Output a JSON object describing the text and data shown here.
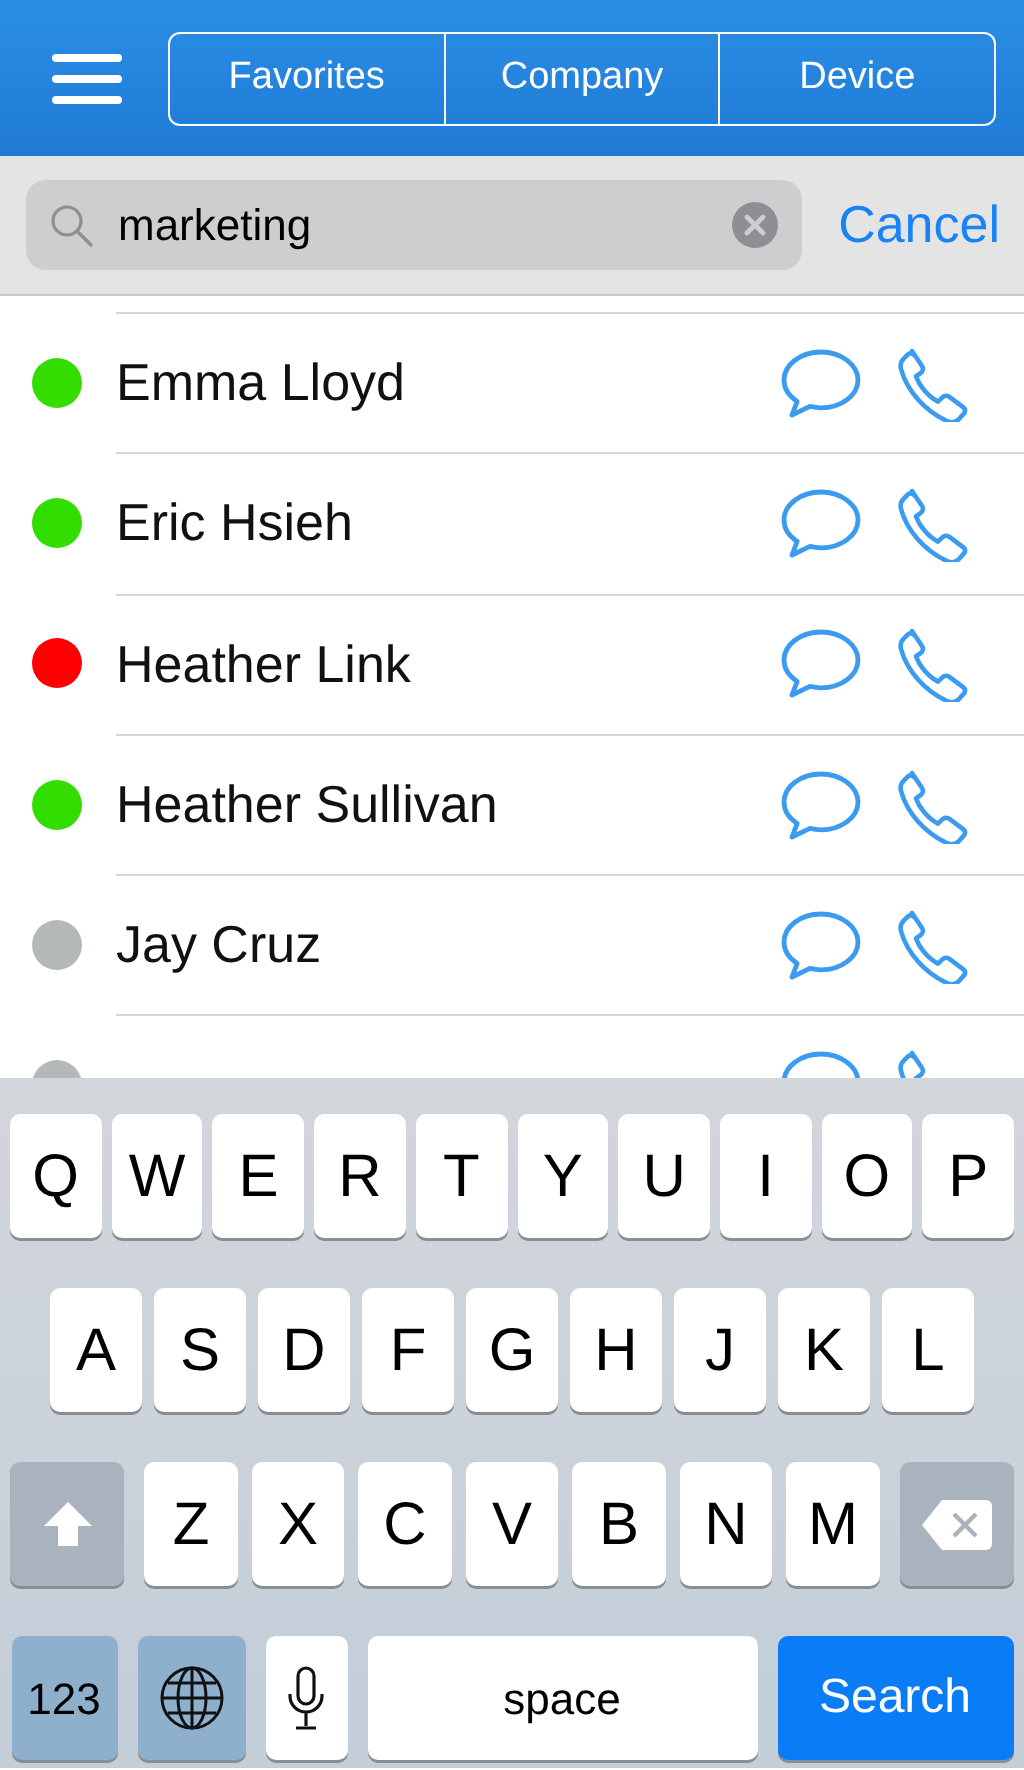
{
  "header": {
    "segments": [
      {
        "label": "Favorites"
      },
      {
        "label": "Company"
      },
      {
        "label": "Device"
      }
    ]
  },
  "search": {
    "value": "marketing",
    "cancel": "Cancel"
  },
  "contacts": [
    {
      "name": "Emma Lloyd",
      "color": "#33dd00"
    },
    {
      "name": "Eric Hsieh",
      "color": "#33dd00"
    },
    {
      "name": "Heather Link",
      "color": "#ff0000"
    },
    {
      "name": "Heather Sullivan",
      "color": "#33dd00"
    },
    {
      "name": "Jay Cruz",
      "color": "#b3b8b8"
    },
    {
      "color": "#b3b8b8"
    }
  ],
  "keyboard": {
    "top_row": [
      {
        "kind": "letter",
        "label": "Q"
      },
      {
        "kind": "letter",
        "label": "W"
      },
      {
        "kind": "letter",
        "label": "E"
      },
      {
        "kind": "letter",
        "label": "R"
      },
      {
        "kind": "letter",
        "label": "T"
      },
      {
        "kind": "letter",
        "label": "Y"
      },
      {
        "kind": "letter",
        "label": "U"
      },
      {
        "kind": "letter",
        "label": "I"
      },
      {
        "kind": "letter",
        "label": "O"
      },
      {
        "kind": "letter",
        "label": "P"
      }
    ],
    "middle_row": [
      {
        "kind": "letter",
        "label": "A"
      },
      {
        "kind": "letter",
        "label": "S"
      },
      {
        "kind": "letter",
        "label": "D"
      },
      {
        "kind": "letter",
        "label": "F"
      },
      {
        "kind": "letter",
        "label": "G"
      },
      {
        "kind": "letter",
        "label": "H"
      },
      {
        "kind": "letter",
        "label": "J"
      },
      {
        "kind": "letter",
        "label": "K"
      },
      {
        "kind": "letter",
        "label": "L"
      }
    ],
    "shift_row": [
      {
        "kind": "shift"
      },
      {
        "kind": "letter",
        "label": "Z"
      },
      {
        "kind": "letter",
        "label": "X"
      },
      {
        "kind": "letter",
        "label": "C"
      },
      {
        "kind": "letter",
        "label": "V"
      },
      {
        "kind": "letter",
        "label": "B"
      },
      {
        "kind": "letter",
        "label": "N"
      },
      {
        "kind": "letter",
        "label": "M"
      },
      {
        "kind": "delete"
      }
    ],
    "bottom_row": [
      {
        "kind": "numbers",
        "label": "123"
      },
      {
        "kind": "globe"
      },
      {
        "kind": "mic"
      },
      {
        "kind": "space",
        "label": "space"
      },
      {
        "kind": "search",
        "label": "Search"
      }
    ]
  }
}
